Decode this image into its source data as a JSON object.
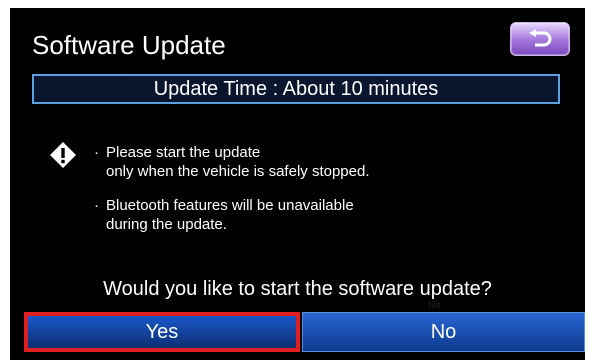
{
  "header": {
    "title": "Software Update",
    "back_icon": "return-arrow-icon"
  },
  "banner": {
    "text": "Update Time : About 10 minutes"
  },
  "notice": {
    "icon": "warning-diamond-icon",
    "items": [
      {
        "line1": "Please start the update",
        "line2": "only when the vehicle is safely stopped."
      },
      {
        "line1": "Bluetooth features will be unavailable",
        "line2": "during the update."
      }
    ]
  },
  "prompt": {
    "question": "Would you like to start the software update?"
  },
  "buttons": {
    "yes": "Yes",
    "no": "No",
    "no_small": "No"
  },
  "colors": {
    "background": "#000000",
    "button_blue": "#1a57c9",
    "highlight_red": "#e02020",
    "banner_border": "#5aa0e0",
    "back_button": "#a77bdd"
  }
}
